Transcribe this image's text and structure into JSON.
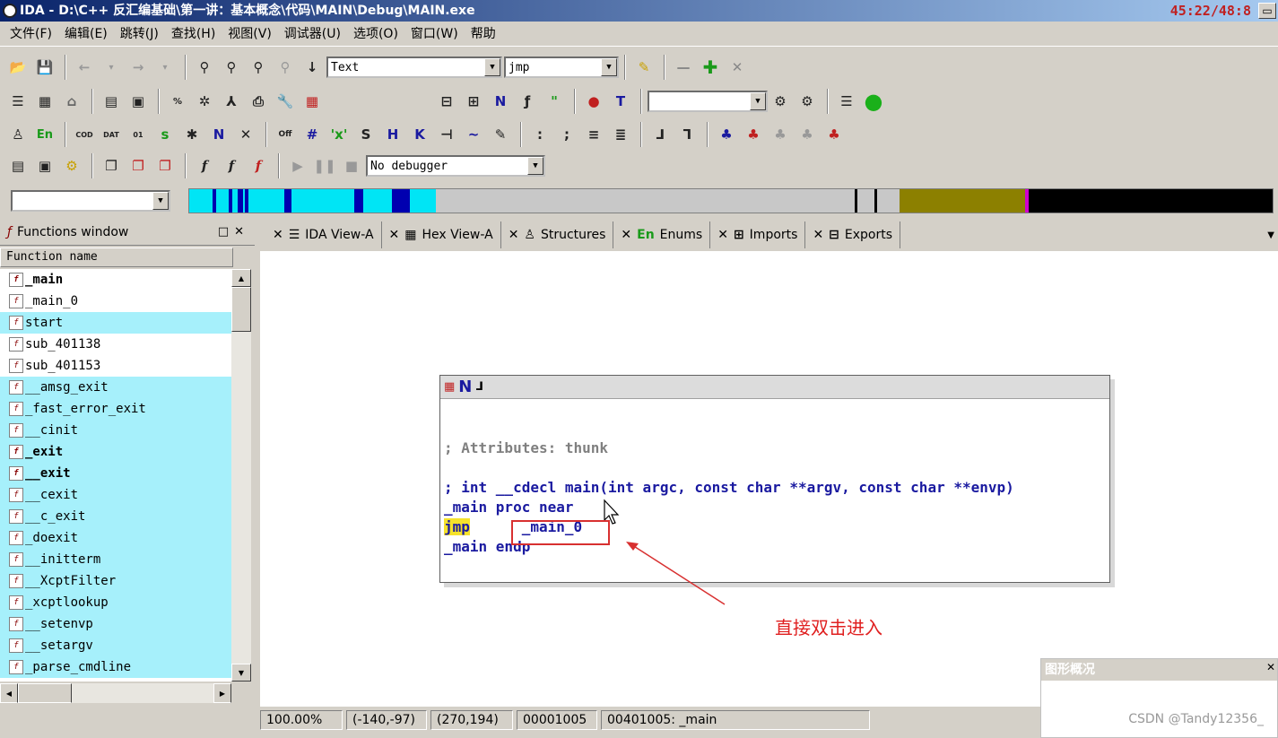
{
  "window": {
    "title": "IDA - D:\\C++ 反汇编基础\\第一讲：基本概念\\代码\\MAIN\\Debug\\MAIN.exe",
    "time_overlay": "45:22/48:8"
  },
  "menu": [
    "文件(F)",
    "编辑(E)",
    "跳转(J)",
    "查找(H)",
    "视图(V)",
    "调试器(U)",
    "选项(O)",
    "窗口(W)",
    "帮助"
  ],
  "toolbar": {
    "search_type": "Text",
    "search_value": "jmp",
    "debugger": "No debugger"
  },
  "functions_window": {
    "title": "Functions window",
    "column": "Function name",
    "items": [
      {
        "name": "_main",
        "bold": true,
        "selected": false
      },
      {
        "name": "_main_0",
        "bold": false,
        "selected": false
      },
      {
        "name": "start",
        "bold": false,
        "selected": true
      },
      {
        "name": "sub_401138",
        "bold": false,
        "selected": false
      },
      {
        "name": "sub_401153",
        "bold": false,
        "selected": false
      },
      {
        "name": "__amsg_exit",
        "bold": false,
        "selected": true
      },
      {
        "name": "_fast_error_exit",
        "bold": false,
        "selected": true
      },
      {
        "name": "__cinit",
        "bold": false,
        "selected": true
      },
      {
        "name": "_exit",
        "bold": true,
        "selected": true
      },
      {
        "name": "__exit",
        "bold": true,
        "selected": true
      },
      {
        "name": "__cexit",
        "bold": false,
        "selected": true
      },
      {
        "name": "__c_exit",
        "bold": false,
        "selected": true
      },
      {
        "name": "_doexit",
        "bold": false,
        "selected": true
      },
      {
        "name": "__initterm",
        "bold": false,
        "selected": true
      },
      {
        "name": "__XcptFilter",
        "bold": false,
        "selected": true
      },
      {
        "name": "_xcptlookup",
        "bold": false,
        "selected": true
      },
      {
        "name": "__setenvp",
        "bold": false,
        "selected": true
      },
      {
        "name": "__setargv",
        "bold": false,
        "selected": true
      },
      {
        "name": "_parse_cmdline",
        "bold": false,
        "selected": true
      }
    ]
  },
  "tabs": [
    {
      "label": "IDA View-A",
      "icon": "☰"
    },
    {
      "label": "Hex View-A",
      "icon": "▦"
    },
    {
      "label": "Structures",
      "icon": "♙"
    },
    {
      "label": "Enums",
      "icon": "En"
    },
    {
      "label": "Imports",
      "icon": "⊞"
    },
    {
      "label": "Exports",
      "icon": "⊟"
    }
  ],
  "graph_node": {
    "comment_line": "; Attributes: thunk",
    "signature_line": "; int __cdecl main(int argc, const char **argv, const char **envp)",
    "proc_line": "_main proc near",
    "jmp_mnemonic": "jmp",
    "jmp_target": "_main_0",
    "endp_line": "_main endp"
  },
  "annotation": "直接双击进入",
  "overview_title": "图形概况",
  "status": {
    "zoom": "100.00%",
    "mouse": "(-140,-97)",
    "size": "(270,194)",
    "offset": "00001005",
    "location": "00401005: _main"
  },
  "watermark": "CSDN @Tandy12356_",
  "colors": {
    "selection": "#a6f0fb",
    "jmp_highlight": "#f5e22b",
    "annotation": "#e02020",
    "code_blue": "#1a1aa0"
  }
}
